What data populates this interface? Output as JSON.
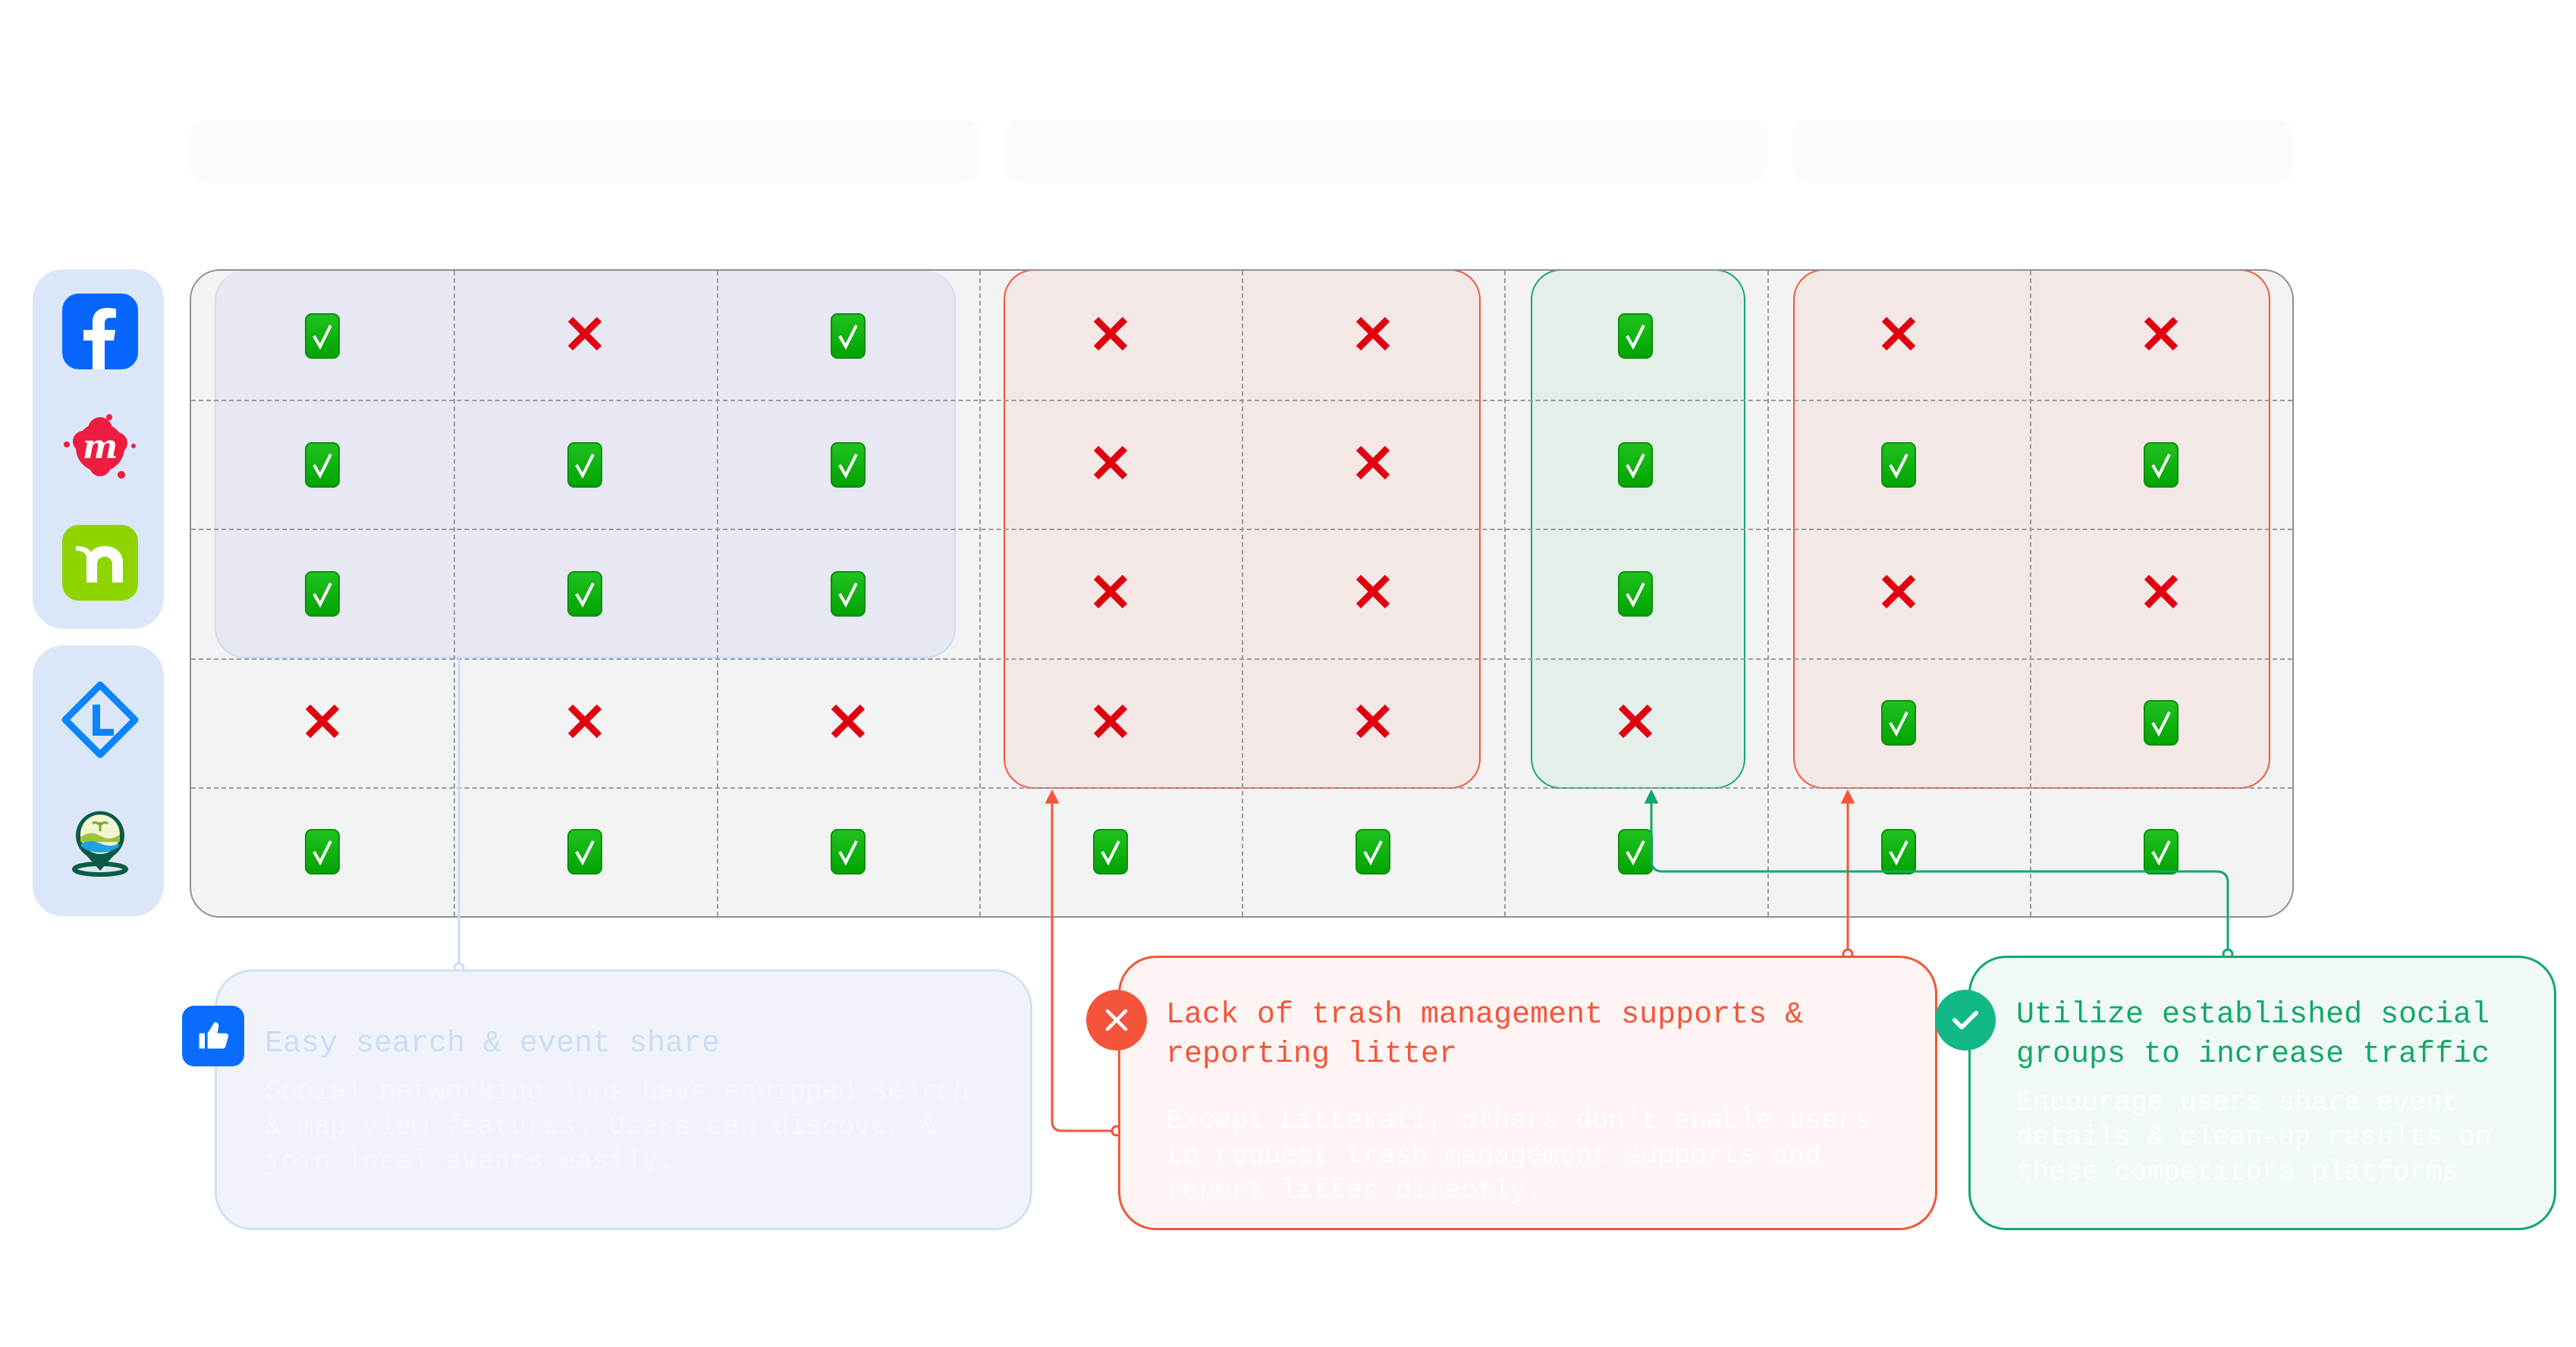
{
  "colors": {
    "panel_bg": "#f3f3f3",
    "blue_group": "#c9dcf5",
    "red_group": "#f4553a",
    "green_group": "#12a86a",
    "check": "#02a302",
    "cross": "#e00010",
    "sidebar_bg": "#dbe7f8"
  },
  "sidebar": {
    "group1": [
      {
        "icon": "facebook-logo-icon"
      },
      {
        "icon": "meetup-logo-icon"
      },
      {
        "icon": "nextdoor-logo-icon"
      }
    ],
    "group2": [
      {
        "icon": "litterati-logo-icon"
      },
      {
        "icon": "cleanup-map-pin-logo-icon"
      }
    ]
  },
  "grid": {
    "rows": [
      [
        "check",
        "cross",
        "check",
        "cross",
        "cross",
        "check",
        "cross",
        "cross"
      ],
      [
        "check",
        "check",
        "check",
        "cross",
        "cross",
        "check",
        "check",
        "check"
      ],
      [
        "check",
        "check",
        "check",
        "cross",
        "cross",
        "check",
        "cross",
        "cross"
      ],
      [
        "cross",
        "cross",
        "cross",
        "cross",
        "cross",
        "cross",
        "check",
        "check"
      ],
      [
        "check",
        "check",
        "check",
        "check",
        "check",
        "check",
        "check",
        "check"
      ]
    ]
  },
  "callouts": {
    "positive": {
      "icon": "thumbs-up-icon",
      "title": "Easy search & event share",
      "body": "Social networking apps have equipped search\n& map view features. Users can discover &\njoin local events easily."
    },
    "negative": {
      "icon": "x-circle-icon",
      "title": "Lack of trash management supports &\nreporting litter",
      "body": "Except Litterati, others don't enable users\nto request trash management supports and\nreport litter directly."
    },
    "opportunity": {
      "icon": "check-circle-icon",
      "title": "Utilize established social\ngroups to increase traffic",
      "body": "Encourage users share event\ndetails & clean-up results on\nthese competitors platforms"
    }
  }
}
